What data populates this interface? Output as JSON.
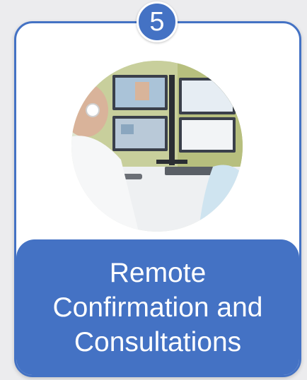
{
  "card": {
    "number": "5",
    "title_lines": [
      "Remote",
      "Confirmation and",
      "Consultations"
    ],
    "accent_color": "#4472c4",
    "image": "photo-two-people-at-multi-monitor-workstation"
  }
}
